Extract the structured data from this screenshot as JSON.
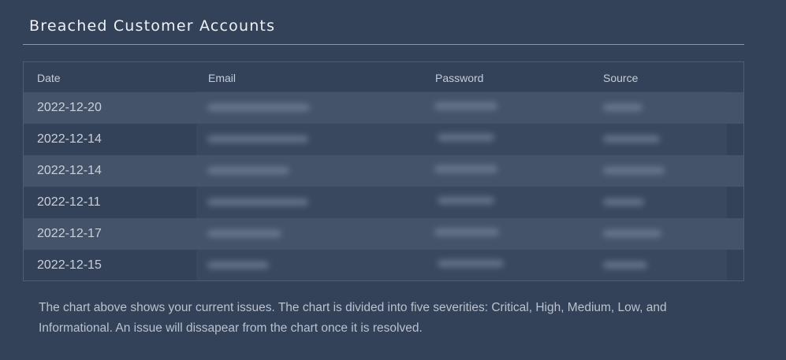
{
  "section": {
    "title": "Breached Customer Accounts"
  },
  "table": {
    "columns": [
      "Date",
      "Email",
      "Password",
      "Source"
    ],
    "rows": [
      {
        "date": "2022-12-20"
      },
      {
        "date": "2022-12-14"
      },
      {
        "date": "2022-12-14"
      },
      {
        "date": "2022-12-11"
      },
      {
        "date": "2022-12-17"
      },
      {
        "date": "2022-12-15"
      }
    ]
  },
  "caption": "The chart above shows your current issues. The chart is divided into five severities: Critical, High, Medium, Low, and Informational. An issue will dissapear from the chart once it is resolved."
}
